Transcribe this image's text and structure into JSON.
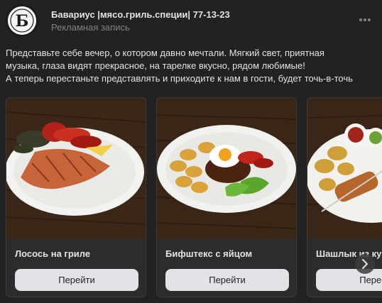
{
  "post": {
    "author_name": "Бавариус |мясо.гриль.специи| 77-13-23",
    "meta": "Рекламная запись",
    "avatar_letter": "Б",
    "text_lines": [
      "Представьте себе вечер, о котором давно мечтали. Мягкий свет, приятная",
      "музыка, глаза видят прекрасное, на тарелке вкусно, рядом любимые!",
      "А теперь перестаньте представлять и приходите к нам в гости, будет точь-в-точь"
    ]
  },
  "cards": [
    {
      "title": "Лосось на гриле",
      "button_label": "Перейти"
    },
    {
      "title": "Бифштекс с яйцом",
      "button_label": "Перейти"
    },
    {
      "title": "Шашлык из курицы",
      "button_label": "Перейти"
    }
  ],
  "icons": {
    "more": "more-horizontal-icon",
    "next": "chevron-right-icon"
  },
  "colors": {
    "background": "#222222",
    "card_background": "#2c2c2c",
    "text_primary": "#e1e3e6",
    "text_secondary": "#828282",
    "button_background": "#e1e3e6"
  }
}
